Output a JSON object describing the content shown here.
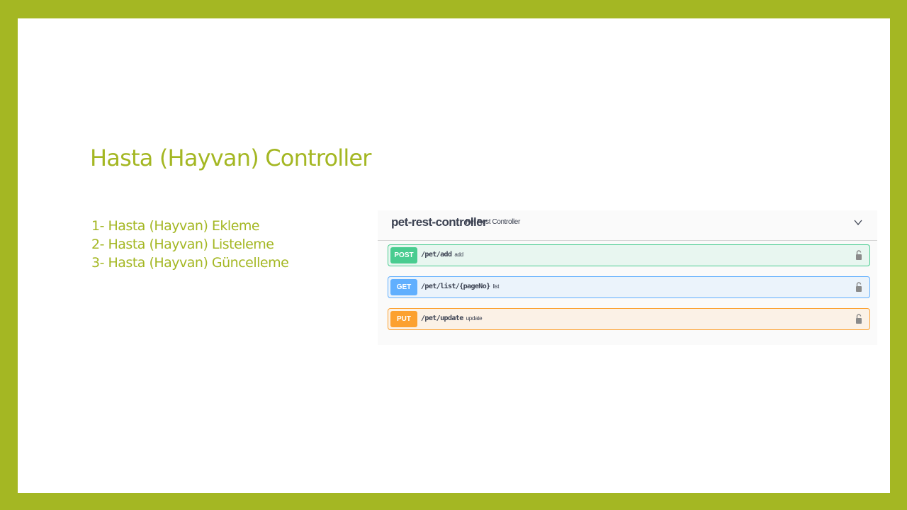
{
  "slide": {
    "title": "Hasta (Hayvan) Controller",
    "bullets": [
      "1- Hasta (Hayvan) Ekleme",
      "2- Hasta (Hayvan) Listeleme",
      "3- Hasta (Hayvan) Güncelleme"
    ]
  },
  "swagger": {
    "tag": {
      "name": "pet-rest-controller",
      "description": "Pet Rest Controller",
      "expanded": true,
      "chevron_icon": "chevron-down-icon"
    },
    "operations": [
      {
        "method": "POST",
        "path": "/pet/add",
        "summary": "add",
        "color": "#49cc90",
        "icon": "lock-icon"
      },
      {
        "method": "GET",
        "path": "/pet/list/{pageNo}",
        "summary": "list",
        "color": "#61affe",
        "icon": "lock-icon"
      },
      {
        "method": "PUT",
        "path": "/pet/update",
        "summary": "update",
        "color": "#fca130",
        "icon": "lock-icon"
      }
    ]
  },
  "colors": {
    "accent": "#a4b723",
    "background": "#ffffff",
    "swagger_text": "#3b4151"
  }
}
